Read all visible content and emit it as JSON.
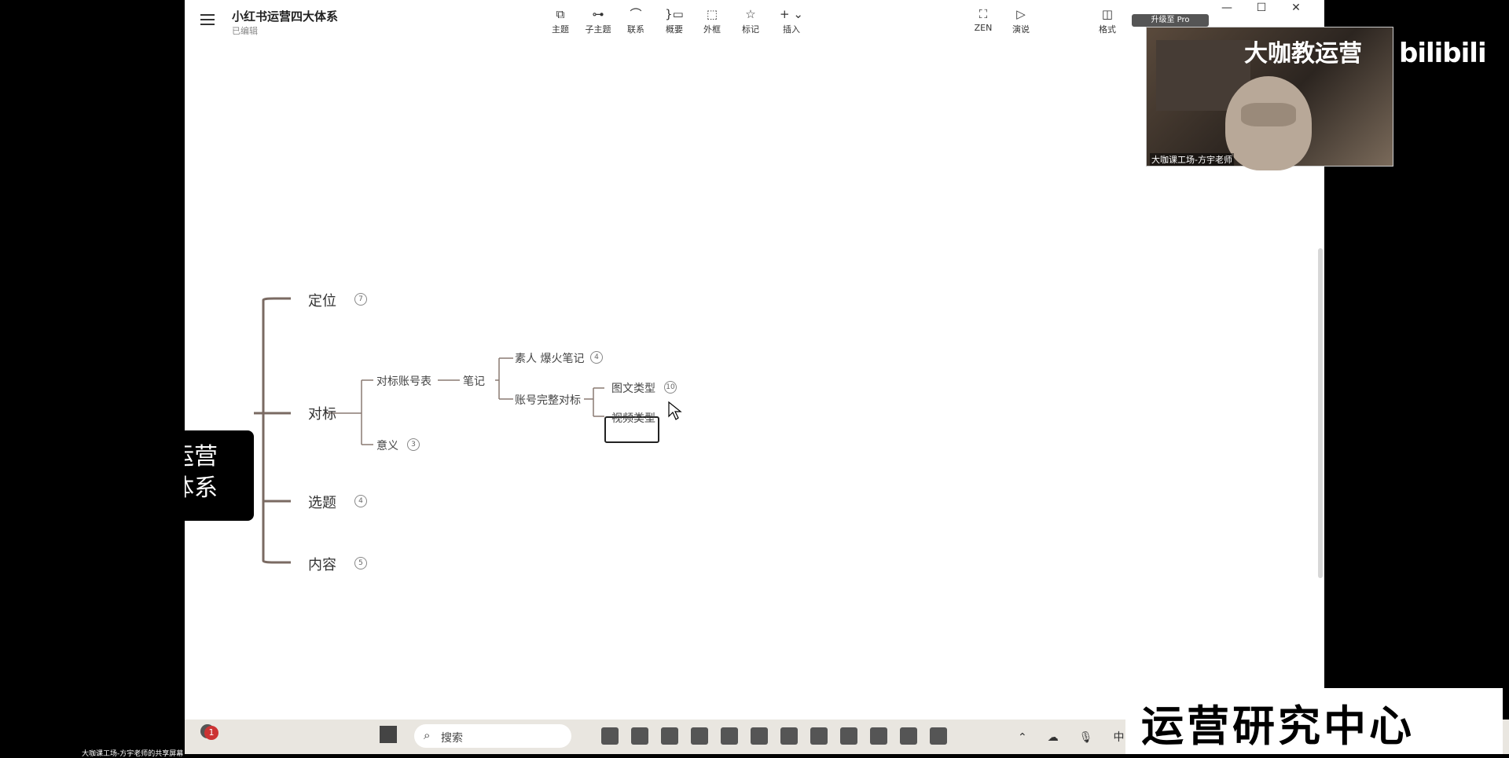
{
  "header": {
    "title": "小红书运营四大体系",
    "status": "已编辑"
  },
  "toolbar": {
    "tools": [
      {
        "label": "主题",
        "icon": "⧉"
      },
      {
        "label": "子主题",
        "icon": "⊶"
      },
      {
        "label": "联系",
        "icon": "⌒"
      },
      {
        "label": "概要",
        "icon": "}▭"
      },
      {
        "label": "外框",
        "icon": "⬚"
      },
      {
        "label": "标记",
        "icon": "☆"
      },
      {
        "label": "插入",
        "icon": "+ ⌄"
      },
      {
        "label": "ZEN",
        "icon": "⛶"
      },
      {
        "label": "演说",
        "icon": "▷"
      },
      {
        "label": "格式",
        "icon": "◫"
      }
    ]
  },
  "pro_badge": "升级至 Pro",
  "mindmap": {
    "central_lines": [
      "运营",
      "体系"
    ],
    "topics": [
      {
        "label": "定位",
        "count": "7"
      },
      {
        "label": "对标"
      },
      {
        "label": "选题",
        "count": "4"
      },
      {
        "label": "内容",
        "count": "5"
      }
    ],
    "duibiao": {
      "child1": "对标账号表",
      "child2": "意义",
      "child2_count": "3",
      "note": "笔记",
      "note_child1": "素人 爆火笔记",
      "note_child1_count": "4",
      "note_child2": "账号完整对标",
      "type1": "图文类型",
      "type1_count": "10",
      "type2": "视频类型"
    }
  },
  "webcam": {
    "title": "大咖教运营",
    "caption": "大咖课工场-方宇老师"
  },
  "bili_logo": "bilibili",
  "taskbar": {
    "search_placeholder": "搜索",
    "ime": "中",
    "bottom_caption": "大咖课工场-方宇老师的共享屏幕"
  },
  "watermark": "运营研究中心",
  "notification_count": "1"
}
